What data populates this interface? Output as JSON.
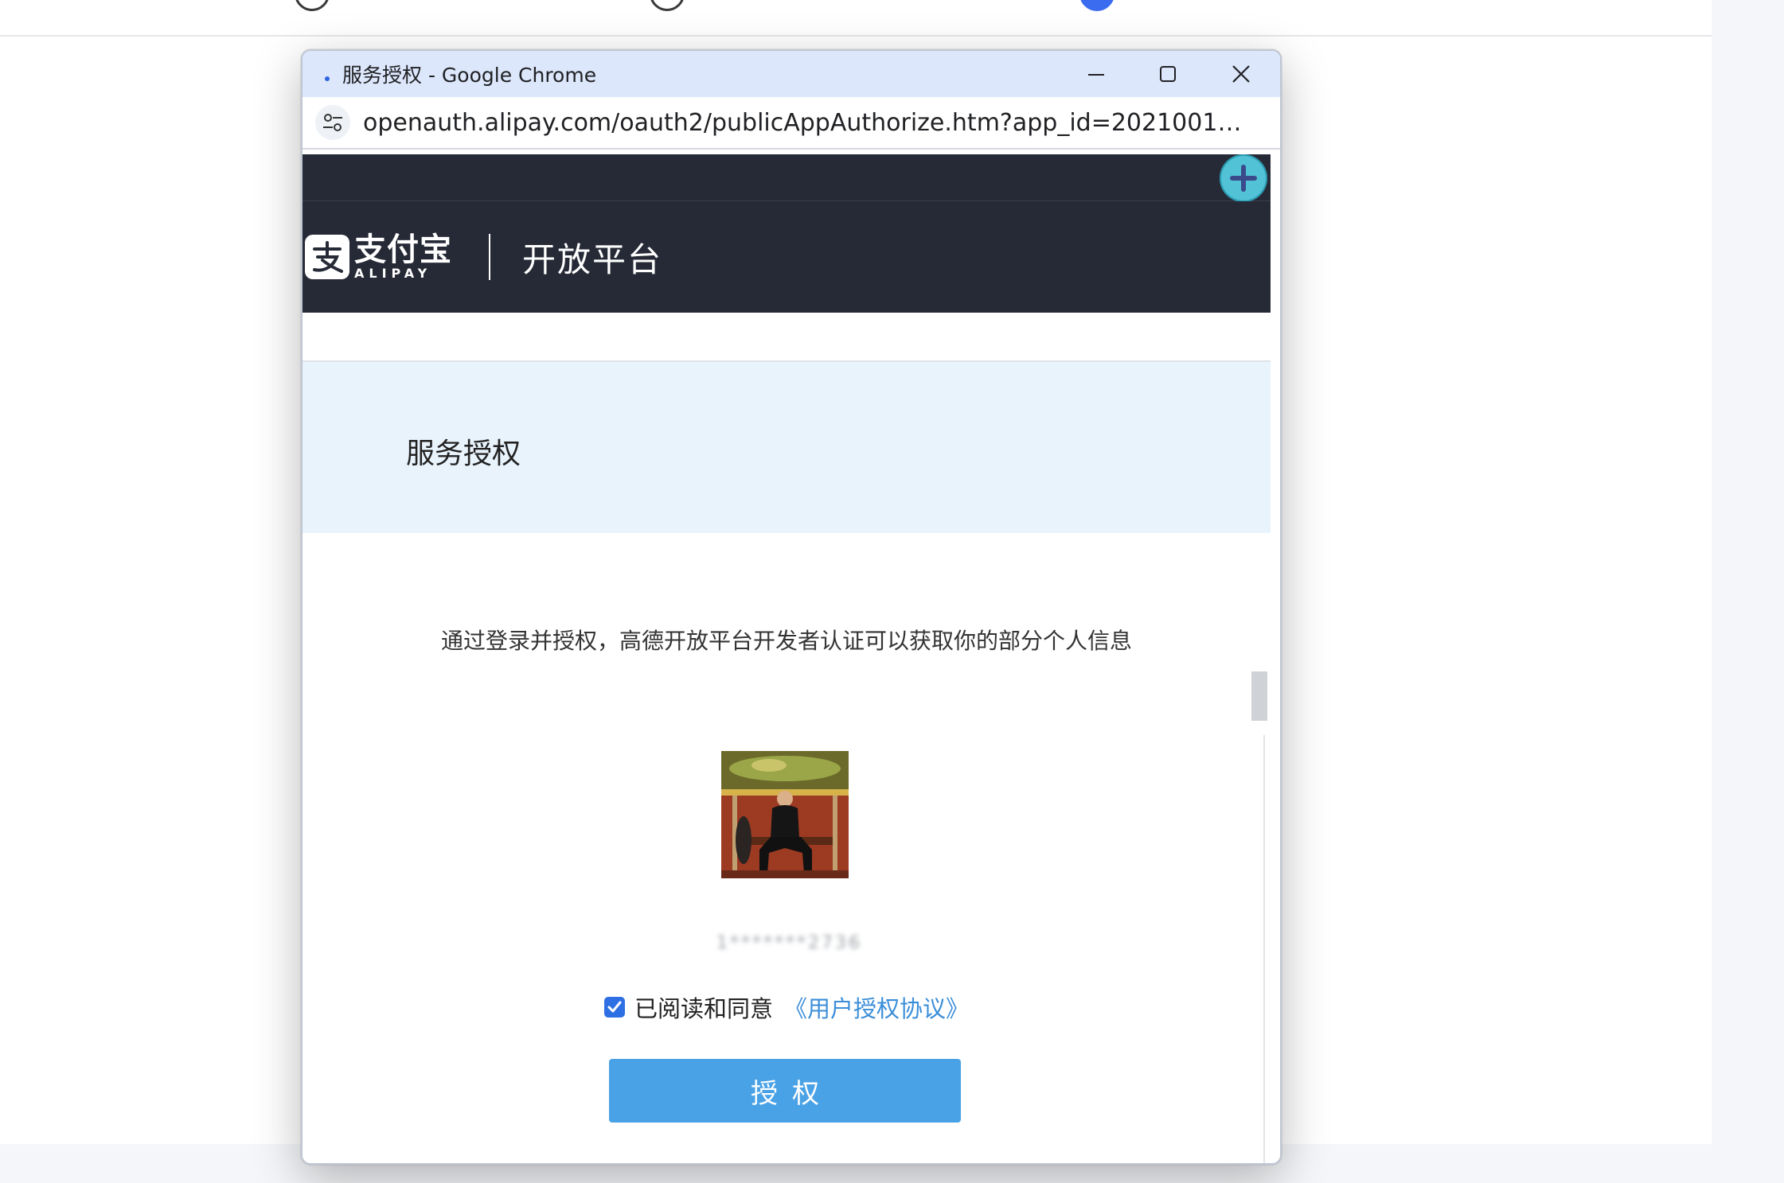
{
  "window": {
    "title": "服务授权 - Google Chrome",
    "url": "openauth.alipay.com/oauth2/publicAppAuthorize.htm?app_id=20210011096630..."
  },
  "header": {
    "logo_cn": "支付宝",
    "logo_en": "ALIPAY",
    "product": "开放平台"
  },
  "page": {
    "section_title": "服务授权",
    "description": "通过登录并授权，高德开放平台开发者认证可以获取你的部分个人信息",
    "account_masked": "1*******2736",
    "agree_checked": true,
    "agree_text": "已阅读和同意",
    "agree_link": "《用户授权协议》",
    "authorize_button": "授权"
  },
  "colors": {
    "header_bg": "#262a36",
    "band_bg": "#e9f3fc",
    "button_bg": "#4aa2e6",
    "link": "#3b8ed9",
    "plus_button": "#52c2d6"
  },
  "icons": {
    "minimize": "minimize-icon",
    "maximize": "maximize-icon",
    "close": "close-icon",
    "site_settings": "tune-icon",
    "plus": "plus-icon"
  }
}
